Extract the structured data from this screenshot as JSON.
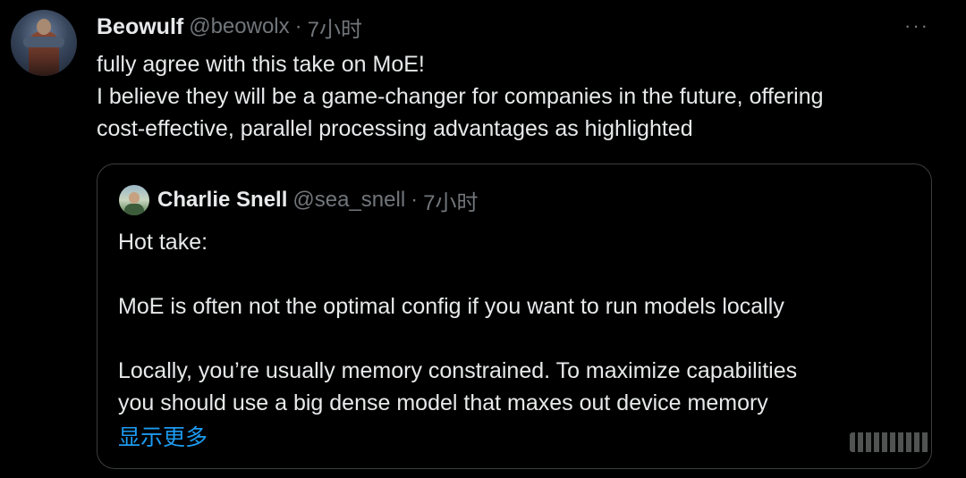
{
  "tweet": {
    "author_name": "Beowulf",
    "author_handle": "@beowolx",
    "separator": "·",
    "time": "7小时",
    "more_icon": "···",
    "lines": [
      "fully agree with this take on MoE!",
      "I believe they will be a game-changer for companies in the future, offering",
      "cost-effective, parallel processing advantages as highlighted"
    ]
  },
  "quote": {
    "author_name": "Charlie Snell",
    "author_handle": "@sea_snell",
    "separator": "·",
    "time": "7小时",
    "lines": [
      "Hot take:",
      "",
      "MoE is often not the optimal config if you want to run models locally",
      "",
      "Locally, you’re usually memory constrained. To maximize capabilities",
      "you should use a big dense model that maxes out device memory"
    ],
    "show_more": "显示更多"
  },
  "colors": {
    "background": "#000000",
    "text_primary": "#e7e9ea",
    "text_secondary": "#71767b",
    "link": "#1d9bf0",
    "border": "#3a3d40"
  }
}
